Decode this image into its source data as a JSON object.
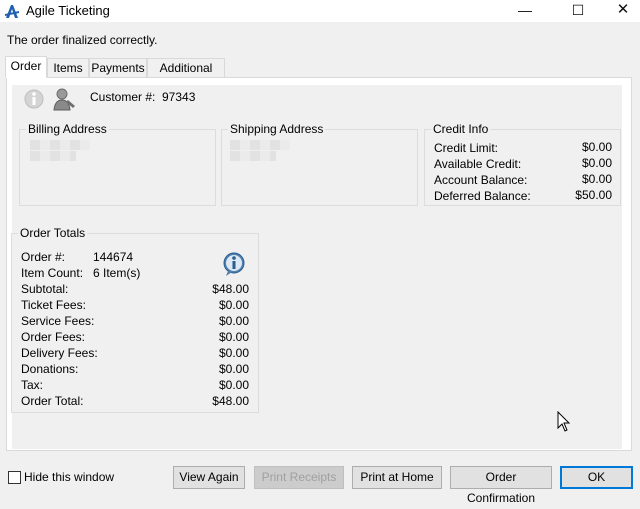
{
  "window": {
    "title": "Agile Ticketing",
    "minimize_symbol": "—",
    "maximize_symbol": "☐",
    "close_symbol": "✕"
  },
  "status_message": "The order finalized correctly.",
  "tabs": [
    {
      "label": "Order",
      "active": true
    },
    {
      "label": "Items",
      "active": false
    },
    {
      "label": "Payments",
      "active": false
    },
    {
      "label": "Additional Info",
      "active": false
    }
  ],
  "customer": {
    "label": "Customer #:",
    "number": "97343"
  },
  "billing": {
    "title": "Billing Address"
  },
  "shipping": {
    "title": "Shipping Address"
  },
  "credit_info": {
    "title": "Credit Info",
    "rows": [
      {
        "label": "Credit Limit:",
        "value": "$0.00"
      },
      {
        "label": "Available Credit:",
        "value": "$0.00"
      },
      {
        "label": "Account Balance:",
        "value": "$0.00"
      },
      {
        "label": "Deferred Balance:",
        "value": "$50.00"
      }
    ]
  },
  "order_totals": {
    "title": "Order Totals",
    "order_number_label": "Order #:",
    "order_number": "144674",
    "item_count_label": "Item Count:",
    "item_count": "6 Item(s)",
    "rows": [
      {
        "label": "Subtotal:",
        "value": "$48.00"
      },
      {
        "label": "Ticket Fees:",
        "value": "$0.00"
      },
      {
        "label": "Service Fees:",
        "value": "$0.00"
      },
      {
        "label": "Order Fees:",
        "value": "$0.00"
      },
      {
        "label": "Delivery Fees:",
        "value": "$0.00"
      },
      {
        "label": "Donations:",
        "value": "$0.00"
      },
      {
        "label": "Tax:",
        "value": "$0.00"
      },
      {
        "label": "Order Total:",
        "value": "$48.00"
      }
    ]
  },
  "footer": {
    "hide_window_label": "Hide this window",
    "hide_window_checked": false,
    "buttons": {
      "view_again": "View Again",
      "print_receipts": "Print Receipts",
      "print_at_home": "Print at Home",
      "order_confirmation": "Order Confirmation",
      "ok": "OK"
    }
  },
  "colors": {
    "accent": "#0078d7",
    "background": "#f0f0f0"
  }
}
